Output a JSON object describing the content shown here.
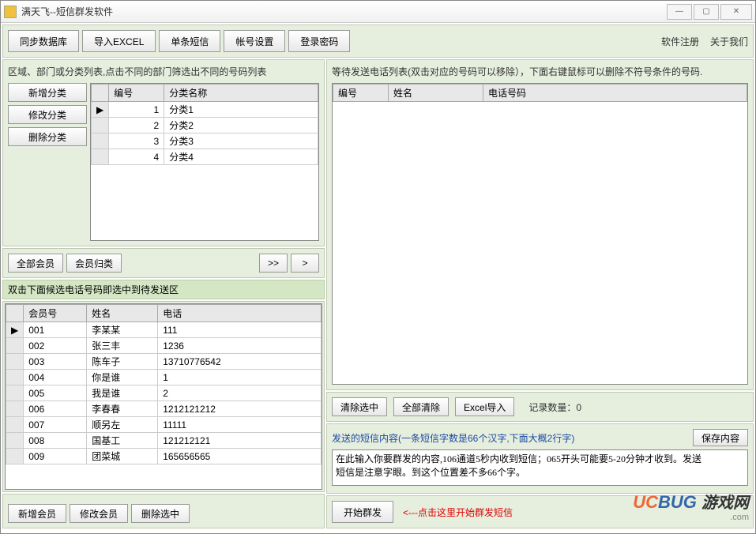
{
  "window": {
    "title": "满天飞--短信群发软件"
  },
  "win_controls": {
    "min": "—",
    "max": "▢",
    "close": "✕"
  },
  "toolbar": {
    "sync": "同步数据库",
    "import_excel": "导入EXCEL",
    "single_sms": "单条短信",
    "account": "帐号设置",
    "login_pwd": "登录密码",
    "register": "软件注册",
    "about": "关于我们"
  },
  "left": {
    "cat_desc": "区域、部门或分类列表,点击不同的部门筛选出不同的号码列表",
    "btn_new_cat": "新增分类",
    "btn_edit_cat": "修改分类",
    "btn_del_cat": "删除分类",
    "cat_headers": {
      "id": "编号",
      "name": "分类名称"
    },
    "categories": [
      {
        "id": "1",
        "name": "分类1"
      },
      {
        "id": "2",
        "name": "分类2"
      },
      {
        "id": "3",
        "name": "分类3"
      },
      {
        "id": "4",
        "name": "分类4"
      }
    ],
    "all_members": "全部会员",
    "member_group": "会员归类",
    "btn_rr": ">>",
    "btn_r": ">",
    "dbl_hint": "双击下面候选电话号码即选中到待发送区",
    "mem_headers": {
      "id": "会员号",
      "name": "姓名",
      "phone": "电话"
    },
    "members": [
      {
        "id": "001",
        "name": "李某某",
        "phone": "111"
      },
      {
        "id": "002",
        "name": "张三丰",
        "phone": "1236"
      },
      {
        "id": "003",
        "name": "陈车子",
        "phone": "13710776542"
      },
      {
        "id": "004",
        "name": "你是谁",
        "phone": "1"
      },
      {
        "id": "005",
        "name": "我是谁",
        "phone": "2"
      },
      {
        "id": "006",
        "name": "李春春",
        "phone": "1212121212"
      },
      {
        "id": "007",
        "name": "顺另左",
        "phone": "11111"
      },
      {
        "id": "008",
        "name": "国基工",
        "phone": "121212121"
      },
      {
        "id": "009",
        "name": "团菜城",
        "phone": "165656565"
      }
    ],
    "btn_new_mem": "新增会员",
    "btn_edit_mem": "修改会员",
    "btn_del_sel": "删除选中"
  },
  "right": {
    "pending_desc": "等待发送电话列表(双击对应的号码可以移除），下面右键鼠标可以删除不符号条件的号码.",
    "pending_headers": {
      "id": "编号",
      "name": "姓名",
      "phone": "电话号码"
    },
    "btn_clear_sel": "清除选中",
    "btn_clear_all": "全部清除",
    "btn_excel_import": "Excel导入",
    "record_count_label": "记录数量：",
    "record_count": "0",
    "msg_title": "发送的短信内容(一条短信字数是66个汉字,下面大概2行字)",
    "btn_save_content": "保存内容",
    "msg_content": "在此输入你要群发的内容,106通道5秒内收到短信；065开头可能要5-20分钟才收到。发送\n短信是注意字眼。到这个位置差不多66个字。",
    "btn_start_send": "开始群发",
    "send_hint": "<---点击这里开始群发短信"
  },
  "watermark": {
    "brand1": "UC",
    "brand2": "BUG",
    "suffix": "游戏网",
    "sub": ".com"
  }
}
